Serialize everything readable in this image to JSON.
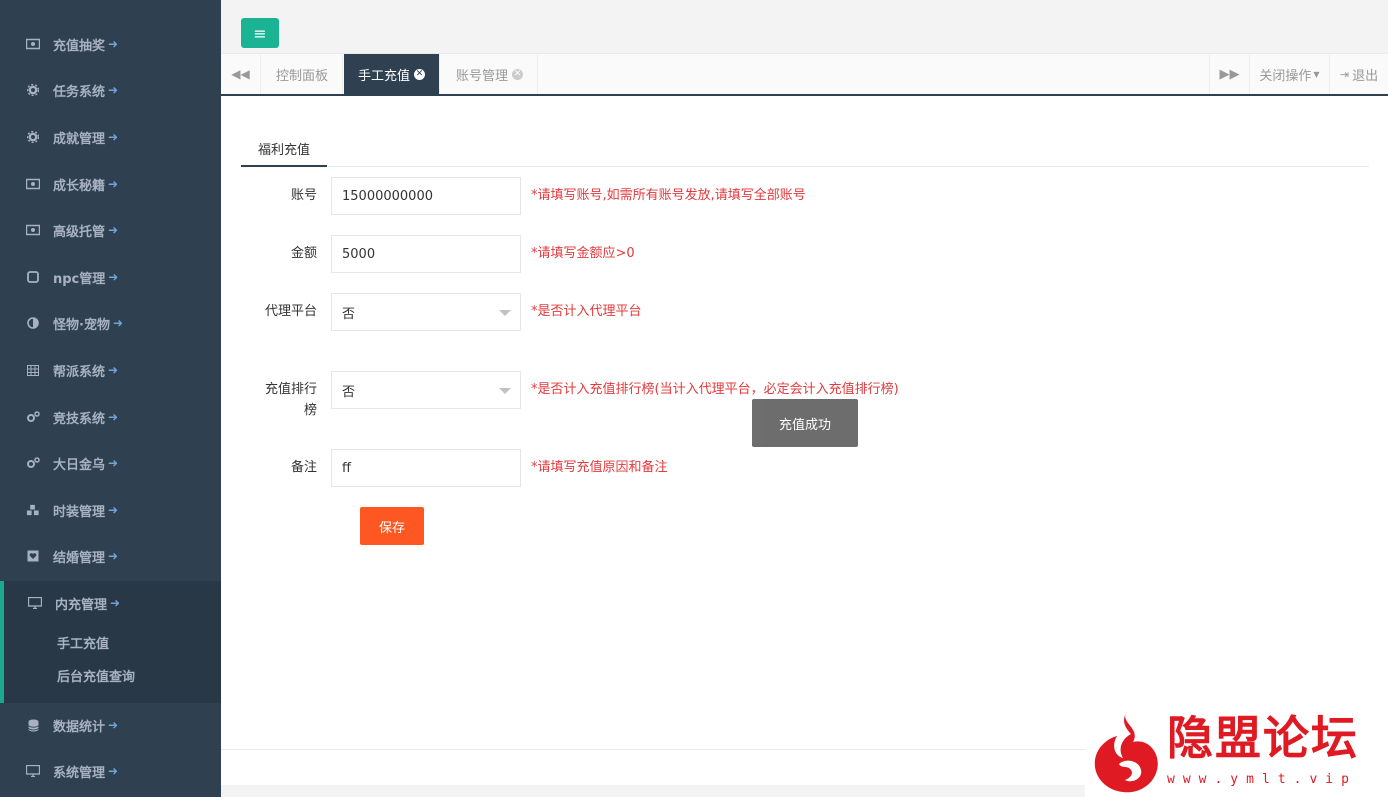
{
  "sidebar": {
    "items": [
      {
        "label": "充值抽奖",
        "icon": "money-icon"
      },
      {
        "label": "任务系统",
        "icon": "gear-icon"
      },
      {
        "label": "成就管理",
        "icon": "gear-icon"
      },
      {
        "label": "成长秘籍",
        "icon": "money-icon"
      },
      {
        "label": "高级托管",
        "icon": "money-icon"
      },
      {
        "label": "npc管理",
        "icon": "square-icon"
      },
      {
        "label": "怪物·宠物",
        "icon": "adjust-icon"
      },
      {
        "label": "帮派系统",
        "icon": "table-icon"
      },
      {
        "label": "竞技系统",
        "icon": "cogs-icon"
      },
      {
        "label": "大日金乌",
        "icon": "cogs-icon"
      },
      {
        "label": "时装管理",
        "icon": "cubes-icon"
      },
      {
        "label": "结婚管理",
        "icon": "heart-icon"
      }
    ],
    "active_group": {
      "label": "内充管理",
      "icon": "desktop-icon",
      "children": [
        "手工充值",
        "后台充值查询"
      ]
    },
    "bottom_items": [
      {
        "label": "数据统计",
        "icon": "database-icon"
      },
      {
        "label": "系统管理",
        "icon": "desktop-icon"
      }
    ],
    "arrow": "➜"
  },
  "topbar": {
    "menu_icon": "≡"
  },
  "tabs": {
    "items": [
      {
        "label": "控制面板",
        "closable": false,
        "active": false
      },
      {
        "label": "手工充值",
        "closable": true,
        "active": true
      },
      {
        "label": "账号管理",
        "closable": true,
        "active": false
      }
    ],
    "close_menu_label": "关闭操作",
    "logout_label": "退出"
  },
  "form": {
    "subtab_label": "福利充值",
    "account": {
      "label": "账号",
      "value": "15000000000",
      "hint": "*请填写账号,如需所有账号发放,请填写全部账号"
    },
    "amount": {
      "label": "金额",
      "value": "5000",
      "hint": "*请填写金额应>0"
    },
    "agent": {
      "label": "代理平台",
      "value": "否",
      "hint": "*是否计入代理平台"
    },
    "ranking": {
      "label": "充值排行榜",
      "value": "否",
      "hint": "*是否计入充值排行榜(当计入代理平台，必定会计入充值排行榜)"
    },
    "remark": {
      "label": "备注",
      "value": "ff",
      "hint": "*请填写充值原因和备注"
    },
    "save_label": "保存"
  },
  "toast": {
    "message": "充值成功"
  },
  "watermark": {
    "title": "隐盟论坛",
    "url": "www.ymlt.vip"
  },
  "colors": {
    "sidebar_bg": "#2f4050",
    "accent_green": "#1ab394",
    "save_orange": "#ff5722",
    "hint_red": "#e4393c",
    "watermark_red": "#e01a22"
  }
}
